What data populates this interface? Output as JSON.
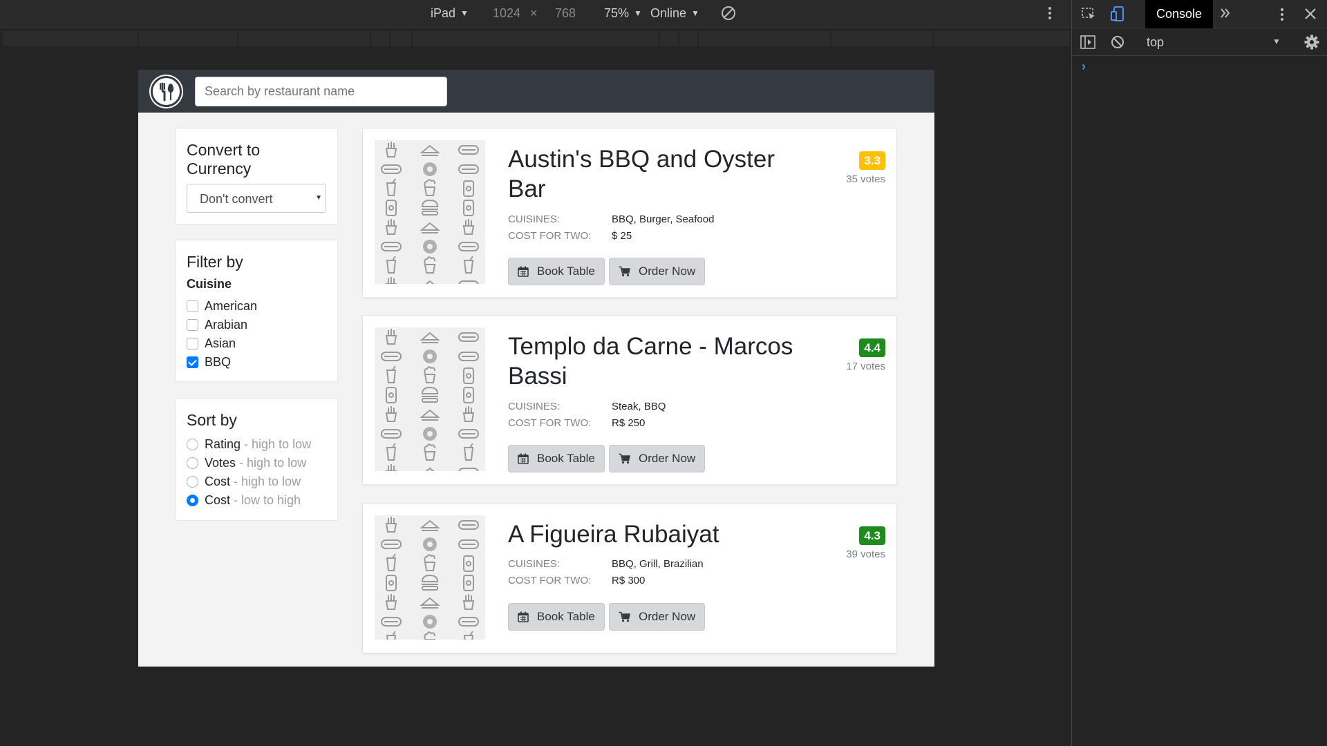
{
  "devtools_toolbar": {
    "device": "iPad",
    "width": "1024",
    "times": "×",
    "height": "768",
    "zoom": "75%",
    "network": "Online"
  },
  "devtools_panel": {
    "tab": "Console",
    "context": "top",
    "prompt": "›"
  },
  "header": {
    "search_placeholder": "Search by restaurant name"
  },
  "currency_panel": {
    "title": "Convert to Currency",
    "selected": "Don't convert"
  },
  "filter_panel": {
    "title": "Filter by",
    "subtitle": "Cuisine",
    "options": [
      {
        "label": "American",
        "checked": false
      },
      {
        "label": "Arabian",
        "checked": false
      },
      {
        "label": "Asian",
        "checked": false
      },
      {
        "label": "BBQ",
        "checked": true
      }
    ]
  },
  "sort_panel": {
    "title": "Sort by",
    "options": [
      {
        "label": "Rating",
        "hint": "- high to low",
        "selected": false
      },
      {
        "label": "Votes",
        "hint": "- high to low",
        "selected": false
      },
      {
        "label": "Cost",
        "hint": "- high to low",
        "selected": false
      },
      {
        "label": "Cost",
        "hint": "- low to high",
        "selected": true
      }
    ]
  },
  "labels": {
    "cuisines": "CUISINES:",
    "cost": "COST FOR TWO:",
    "book": "Book Table",
    "order": "Order Now"
  },
  "restaurants": [
    {
      "name": "Austin's BBQ and Oyster Bar",
      "cuisines": "BBQ, Burger, Seafood",
      "cost": "$ 25",
      "rating": "3.3",
      "votes": "35 votes",
      "rating_color": "#ffc107",
      "rating_text_color": "#ffffff"
    },
    {
      "name": "Templo da Carne - Marcos Bassi",
      "cuisines": "Steak, BBQ",
      "cost": "R$ 250",
      "rating": "4.4",
      "votes": "17 votes",
      "rating_color": "#1e8b1e",
      "rating_text_color": "#ffffff"
    },
    {
      "name": "A Figueira Rubaiyat",
      "cuisines": "BBQ, Grill, Brazilian",
      "cost": "R$ 300",
      "rating": "4.3",
      "votes": "39 votes",
      "rating_color": "#1e8b1e",
      "rating_text_color": "#ffffff"
    }
  ]
}
